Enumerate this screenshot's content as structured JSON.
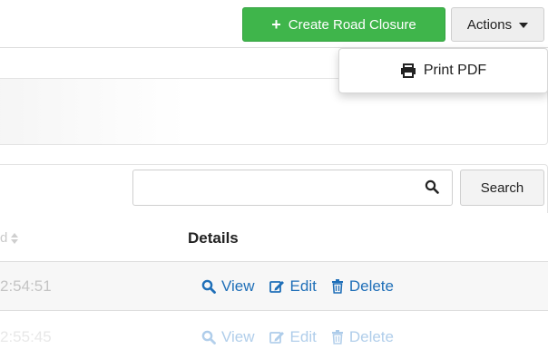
{
  "header": {
    "create_button_label": "Create Road Closure",
    "actions_button_label": "Actions"
  },
  "actions_menu": {
    "items": [
      {
        "label": "Print PDF",
        "icon": "printer-icon"
      }
    ]
  },
  "search": {
    "value": "",
    "placeholder": "",
    "button_label": "Search",
    "icon": "search-icon"
  },
  "table": {
    "columns": [
      {
        "label": "d"
      },
      {
        "label": "Details"
      }
    ],
    "rows": [
      {
        "time": "2:54:51",
        "actions": {
          "view": "View",
          "edit": "Edit",
          "delete": "Delete"
        }
      },
      {
        "time": "2:55:45",
        "actions": {
          "view": "View",
          "edit": "Edit",
          "delete": "Delete"
        }
      }
    ]
  },
  "colors": {
    "create_button_bg": "#3fb54b",
    "link_blue": "#1f6fb8",
    "link_blue_faded": "#9fc3e6"
  }
}
